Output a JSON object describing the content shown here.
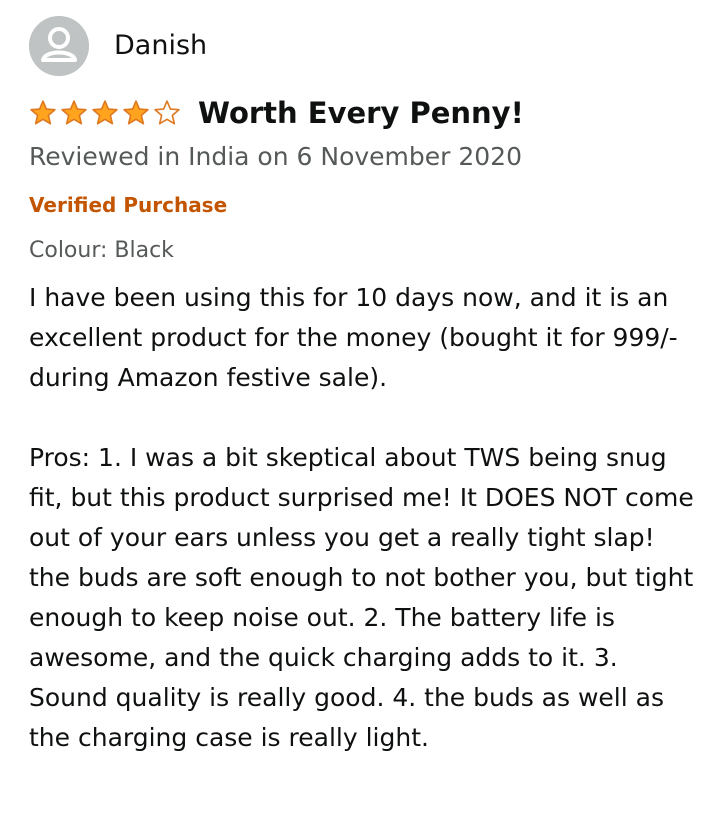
{
  "reviewer": {
    "name": "Danish",
    "avatar_icon": "user-silhouette-icon"
  },
  "review": {
    "rating": 4,
    "rating_max": 5,
    "star_color": "#ffa41c",
    "star_outline_color": "#de7921",
    "title": "Worth Every Penny!",
    "date": "Reviewed in India on 6 November 2020",
    "verified": "Verified Purchase",
    "verified_color": "#c45500",
    "variant": "Colour: Black",
    "paragraphs": [
      "I have been using this for 10 days now, and it is an excellent product for the money (bought it for 999/- during Amazon festive sale).",
      "Pros: 1. I was a bit skeptical about TWS being snug fit, but this product surprised me! It DOES NOT come out of your ears unless you get a really tight slap! the buds are soft enough to not bother you, but tight enough to keep noise out. 2. The battery life is awesome, and the quick charging adds to it. 3. Sound quality is really good. 4. the buds as well as the charging case is really light."
    ]
  }
}
